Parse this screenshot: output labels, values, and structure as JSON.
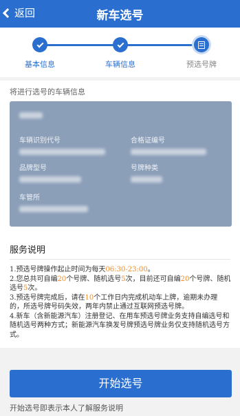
{
  "navbar": {
    "back_label": "返回",
    "title": "新车选号"
  },
  "steps": [
    {
      "label": "基本信息",
      "state": "done"
    },
    {
      "label": "车辆信息",
      "state": "done"
    },
    {
      "label": "预选号牌",
      "state": "active"
    }
  ],
  "vehicle": {
    "note": "将进行选号的车辆信息",
    "fields": {
      "vin_label": "车辆识别代号",
      "cert_label": "合格证编号",
      "model_label": "品牌型号",
      "plate_type_label": "号牌种类",
      "office_label": "车管所"
    }
  },
  "service": {
    "title": "服务说明",
    "rule1_a": "1.预选号牌操作起止时间为每天",
    "rule1_time": "06:30-23:00",
    "rule1_b": "。",
    "rule2_a": "2.您总共可自编",
    "rule2_n1": "20",
    "rule2_b": "个号牌、随机选号",
    "rule2_n2": "5",
    "rule2_c": "次，目前还可自编",
    "rule2_n3": "20",
    "rule2_d": "个号牌、随机选号",
    "rule2_n4": "5",
    "rule2_e": "次。",
    "rule3_a": "3.预选号牌完成后，请在",
    "rule3_n": "10",
    "rule3_b": "个工作日内完成机动车上牌，逾期未办理的，所选号牌号码失效，两年内禁止通过互联网预选号牌。",
    "rule4": "4.新车（含新能源汽车）注册登记、在用车预选号牌业务支持自编选号和随机选号两种方式；新能源汽车换发号牌预选号牌业务仅支持随机选号方式。"
  },
  "start_button": "开始选号",
  "footer_note": "开始选号即表示本人了解服务说明",
  "colors": {
    "primary": "#2a6fcf",
    "highlight": "#f08a24",
    "card": "#8c9fb9"
  }
}
